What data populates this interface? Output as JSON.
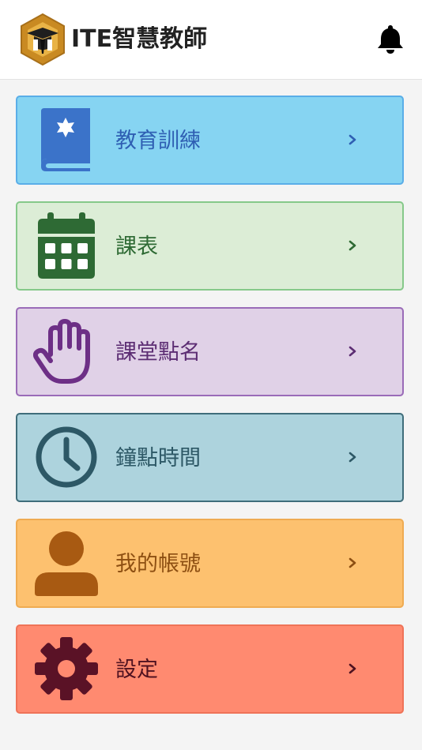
{
  "header": {
    "title": "ITE智慧教師",
    "logo_icon": "ite-mortarboard-logo",
    "notification_icon": "bell-icon"
  },
  "colors": {
    "header_bg": "#ffffff",
    "page_bg": "#f4f4f4"
  },
  "menu": {
    "items": [
      {
        "label": "教育訓練",
        "icon": "book-icon",
        "bg": "#86d4f2",
        "border": "#5aaee8",
        "icon_color": "#3b73c9",
        "text_color": "#2f5fb3"
      },
      {
        "label": "課表",
        "icon": "calendar-icon",
        "bg": "#dcedd6",
        "border": "#86c98a",
        "icon_color": "#2e6a34",
        "text_color": "#2e6a34"
      },
      {
        "label": "課堂點名",
        "icon": "hand-icon",
        "bg": "#e0d1e7",
        "border": "#9a6bb8",
        "icon_color": "#6d2f86",
        "text_color": "#5c2d73"
      },
      {
        "label": "鐘點時間",
        "icon": "clock-icon",
        "bg": "#add3dd",
        "border": "#3f6d7a",
        "icon_color": "#2d5866",
        "text_color": "#2d5866"
      },
      {
        "label": "我的帳號",
        "icon": "user-icon",
        "bg": "#fdc16f",
        "border": "#efab52",
        "icon_color": "#a85a12",
        "text_color": "#8d4f12"
      },
      {
        "label": "設定",
        "icon": "gear-icon",
        "bg": "#ff8a70",
        "border": "#ef7358",
        "icon_color": "#5a1226",
        "text_color": "#4f1220"
      }
    ]
  }
}
